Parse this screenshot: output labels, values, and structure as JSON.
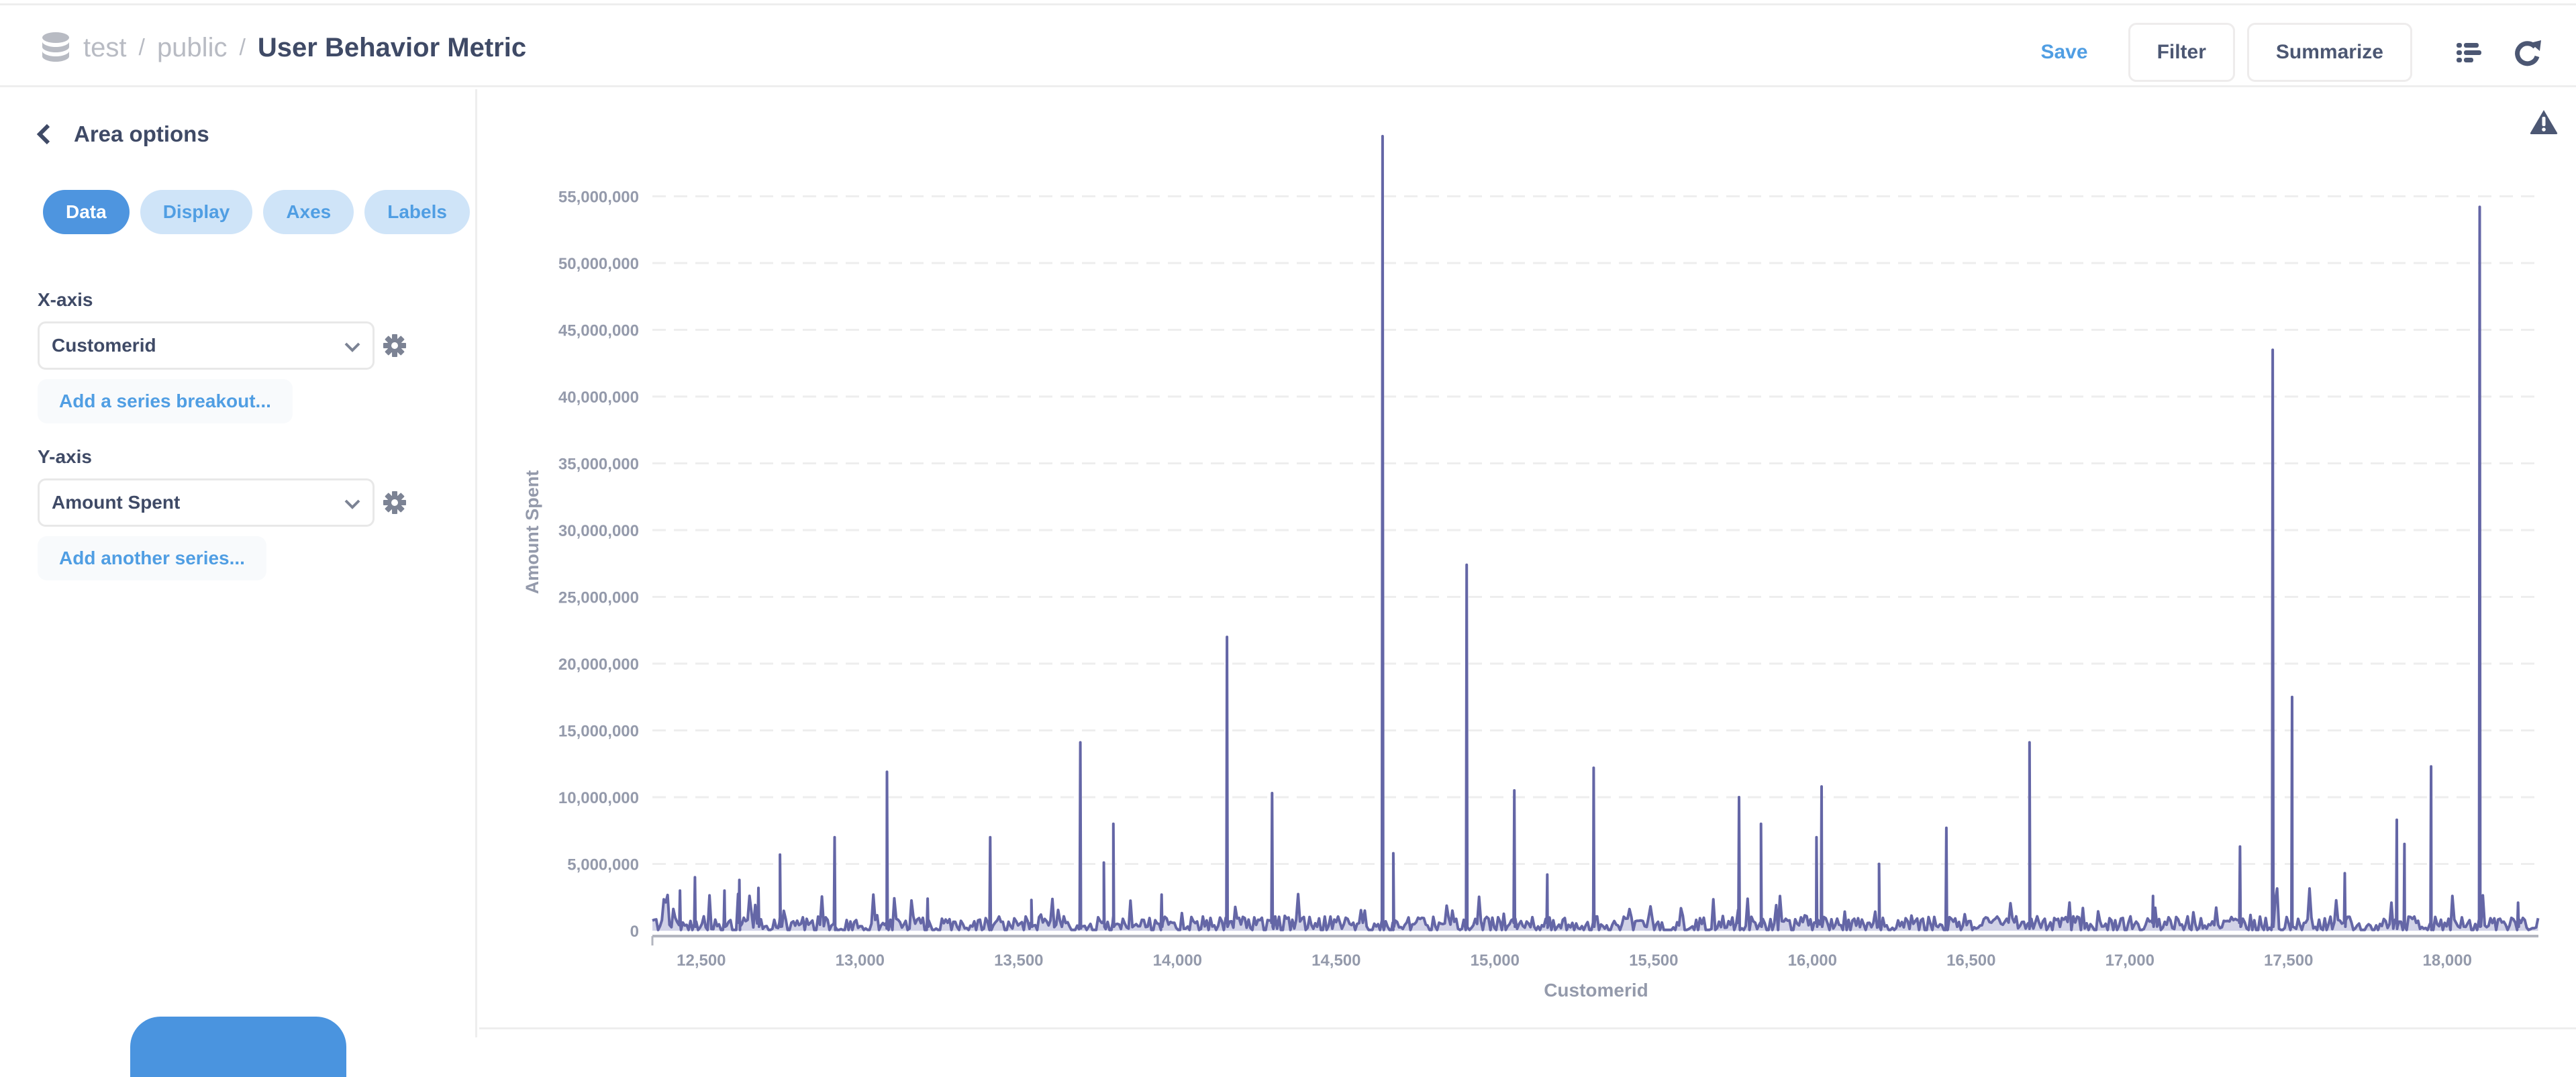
{
  "header": {
    "breadcrumb": [
      "test",
      "public"
    ],
    "separator": "/",
    "title": "User Behavior Metric",
    "save_label": "Save",
    "filter_label": "Filter",
    "summarize_label": "Summarize",
    "icons": [
      "database-icon",
      "notebook-list-icon",
      "refresh-icon"
    ]
  },
  "sidebar": {
    "back_title": "Area options",
    "tabs": [
      {
        "label": "Data",
        "active": true
      },
      {
        "label": "Display",
        "active": false
      },
      {
        "label": "Axes",
        "active": false
      },
      {
        "label": "Labels",
        "active": false
      }
    ],
    "x_axis": {
      "label": "X-axis",
      "value": "Customerid",
      "add_label": "Add a series breakout..."
    },
    "y_axis": {
      "label": "Y-axis",
      "value": "Amount Spent",
      "add_label": "Add another series..."
    }
  },
  "colors": {
    "accent": "#509ee3",
    "series": "#6466a6",
    "series_fill": "#cfd0e6",
    "axis_text": "#949aab",
    "title_text": "#3f4a66"
  },
  "chart_data": {
    "type": "area",
    "title": "",
    "xlabel": "Customerid",
    "ylabel": "Amount Spent",
    "xlim": [
      12346,
      18287
    ],
    "ylim": [
      0,
      60000000
    ],
    "x_ticks": [
      12500,
      13000,
      13500,
      14000,
      14500,
      15000,
      15500,
      16000,
      16500,
      17000,
      17500,
      18000
    ],
    "x_tick_labels": [
      "12,500",
      "13,000",
      "13,500",
      "14,000",
      "14,500",
      "15,000",
      "15,500",
      "16,000",
      "16,500",
      "17,000",
      "17,500",
      "18,000"
    ],
    "y_ticks": [
      0,
      5000000,
      10000000,
      15000000,
      20000000,
      25000000,
      30000000,
      35000000,
      40000000,
      45000000,
      50000000,
      55000000
    ],
    "y_tick_labels": [
      "0",
      "5,000,000",
      "10,000,000",
      "15,000,000",
      "20,000,000",
      "25,000,000",
      "30,000,000",
      "35,000,000",
      "40,000,000",
      "45,000,000",
      "50,000,000",
      "55,000,000"
    ],
    "grid": true,
    "legend": "none",
    "series": [
      {
        "name": "Amount Spent",
        "peaks": [
          {
            "x": 12433,
            "y": 3000000
          },
          {
            "x": 12480,
            "y": 4000000
          },
          {
            "x": 12573,
            "y": 3000000
          },
          {
            "x": 12620,
            "y": 3800000
          },
          {
            "x": 12680,
            "y": 3200000
          },
          {
            "x": 12748,
            "y": 5700000
          },
          {
            "x": 12920,
            "y": 7000000
          },
          {
            "x": 13085,
            "y": 11900000
          },
          {
            "x": 13213,
            "y": 2400000
          },
          {
            "x": 13410,
            "y": 7000000
          },
          {
            "x": 13540,
            "y": 2300000
          },
          {
            "x": 13694,
            "y": 14100000
          },
          {
            "x": 13768,
            "y": 5100000
          },
          {
            "x": 13798,
            "y": 8000000
          },
          {
            "x": 13950,
            "y": 2700000
          },
          {
            "x": 14156,
            "y": 22000000
          },
          {
            "x": 14298,
            "y": 10300000
          },
          {
            "x": 14646,
            "y": 59500000
          },
          {
            "x": 14680,
            "y": 5800000
          },
          {
            "x": 14911,
            "y": 27400000
          },
          {
            "x": 15061,
            "y": 10500000
          },
          {
            "x": 15165,
            "y": 4200000
          },
          {
            "x": 15311,
            "y": 12200000
          },
          {
            "x": 15769,
            "y": 10000000
          },
          {
            "x": 15838,
            "y": 8000000
          },
          {
            "x": 16013,
            "y": 7000000
          },
          {
            "x": 16029,
            "y": 10800000
          },
          {
            "x": 16210,
            "y": 5000000
          },
          {
            "x": 16422,
            "y": 7700000
          },
          {
            "x": 16684,
            "y": 14100000
          },
          {
            "x": 17073,
            "y": 2600000
          },
          {
            "x": 17347,
            "y": 6300000
          },
          {
            "x": 17450,
            "y": 43500000
          },
          {
            "x": 17511,
            "y": 17500000
          },
          {
            "x": 17677,
            "y": 4300000
          },
          {
            "x": 17841,
            "y": 8300000
          },
          {
            "x": 17865,
            "y": 6500000
          },
          {
            "x": 17949,
            "y": 12300000
          },
          {
            "x": 18102,
            "y": 54200000
          },
          {
            "x": 18223,
            "y": 2100000
          }
        ],
        "baseline_typical": 600000
      }
    ]
  }
}
